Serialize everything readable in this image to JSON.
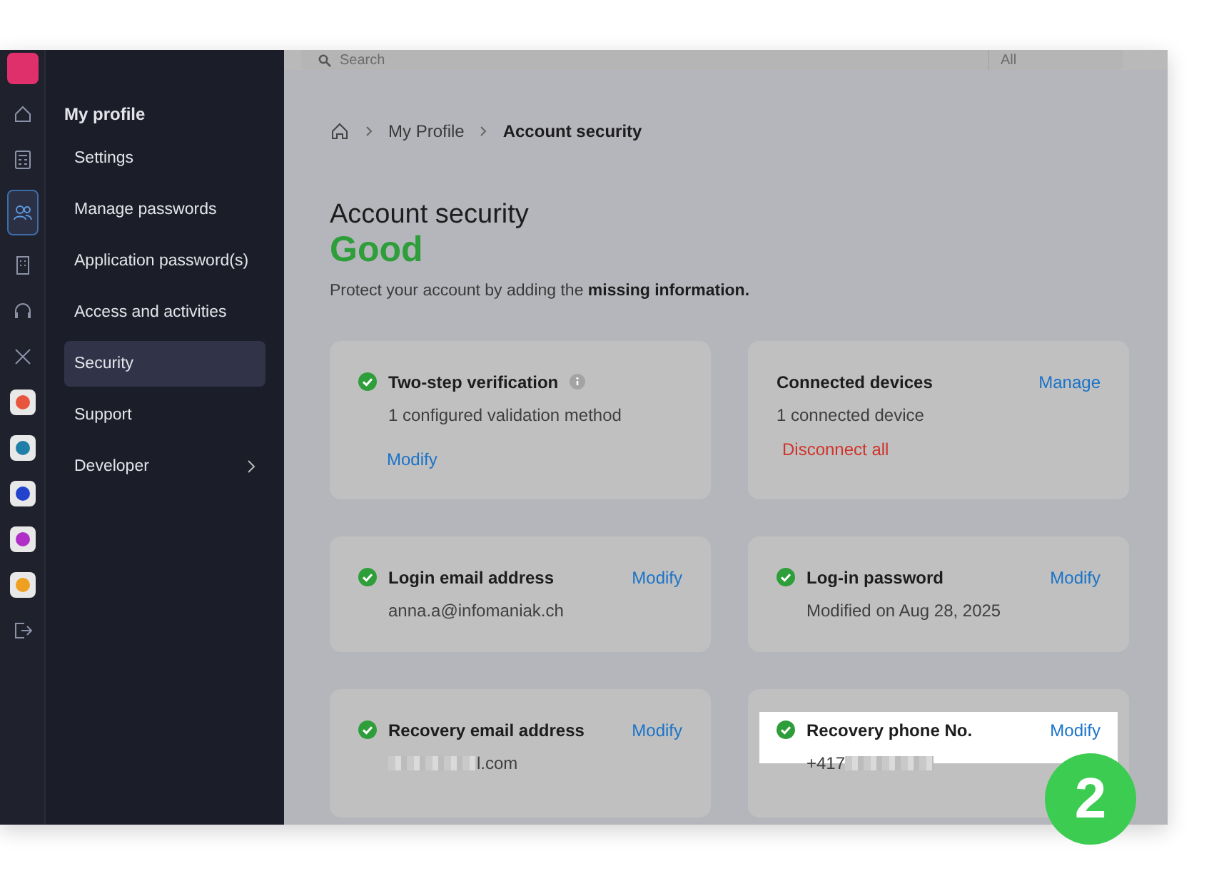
{
  "search": {
    "placeholder": "Search",
    "filter": "All"
  },
  "rail": {
    "items": [
      {
        "kind": "logo",
        "selected": false
      },
      {
        "kind": "home",
        "selected": false
      },
      {
        "kind": "calculator",
        "selected": false
      },
      {
        "kind": "people",
        "selected": true
      },
      {
        "kind": "building",
        "selected": false
      },
      {
        "kind": "headset",
        "selected": false
      },
      {
        "kind": "tools",
        "selected": false
      },
      {
        "kind": "app",
        "color": "#e8553f",
        "selected": false
      },
      {
        "kind": "app",
        "color": "#1f7fa8",
        "selected": false
      },
      {
        "kind": "app",
        "color": "#2244cc",
        "selected": false
      },
      {
        "kind": "app",
        "color": "#b02fc9",
        "selected": false
      },
      {
        "kind": "app",
        "color": "#f0a020",
        "selected": false
      },
      {
        "kind": "logout",
        "selected": false
      }
    ]
  },
  "sidebar": {
    "section": "My profile",
    "items": [
      {
        "label": "Settings",
        "selected": false,
        "submenu": false
      },
      {
        "label": "Manage passwords",
        "selected": false,
        "submenu": false
      },
      {
        "label": "Application password(s)",
        "selected": false,
        "submenu": false
      },
      {
        "label": "Access and activities",
        "selected": false,
        "submenu": false
      },
      {
        "label": "Security",
        "selected": true,
        "submenu": false
      },
      {
        "label": "Support",
        "selected": false,
        "submenu": false
      },
      {
        "label": "Developer",
        "selected": false,
        "submenu": true
      }
    ]
  },
  "breadcrumb": [
    "My Profile",
    "Account security"
  ],
  "page": {
    "title": "Account security",
    "status": "Good",
    "description": "Protect your account by adding the **missing information.**"
  },
  "cards": [
    {
      "title": "Two-step verification",
      "verified": true,
      "info": true,
      "lines": [
        {
          "kind": "text",
          "text": "1 configured validation method"
        }
      ],
      "bottom_link": "Modify",
      "highlighted": false
    },
    {
      "title": "Connected devices",
      "verified": false,
      "info": false,
      "lines": [
        {
          "kind": "text",
          "text": "1 connected device"
        }
      ],
      "action": "Manage",
      "danger_link": "Disconnect all",
      "highlighted": false
    },
    {
      "title": "Login email address",
      "verified": true,
      "info": false,
      "lines": [
        {
          "kind": "text",
          "text": "anna.a@infomaniak.ch"
        }
      ],
      "action": "Modify",
      "highlighted": false
    },
    {
      "title": "Log-in password",
      "verified": true,
      "info": false,
      "lines": [
        {
          "kind": "text",
          "text": "Modified on Aug 28, 2025"
        }
      ],
      "action": "Modify",
      "highlighted": false
    },
    {
      "title": "Recovery email address",
      "verified": true,
      "info": false,
      "lines": [
        {
          "kind": "redacted"
        },
        {
          "kind": "text",
          "text": "l.com"
        }
      ],
      "action": "Modify",
      "highlighted": false
    },
    {
      "title": "Recovery phone No.",
      "verified": true,
      "info": false,
      "lines": [
        {
          "kind": "text",
          "text": "+417"
        },
        {
          "kind": "redacted"
        }
      ],
      "action": "Modify",
      "highlighted": true
    }
  ],
  "callout": "2"
}
